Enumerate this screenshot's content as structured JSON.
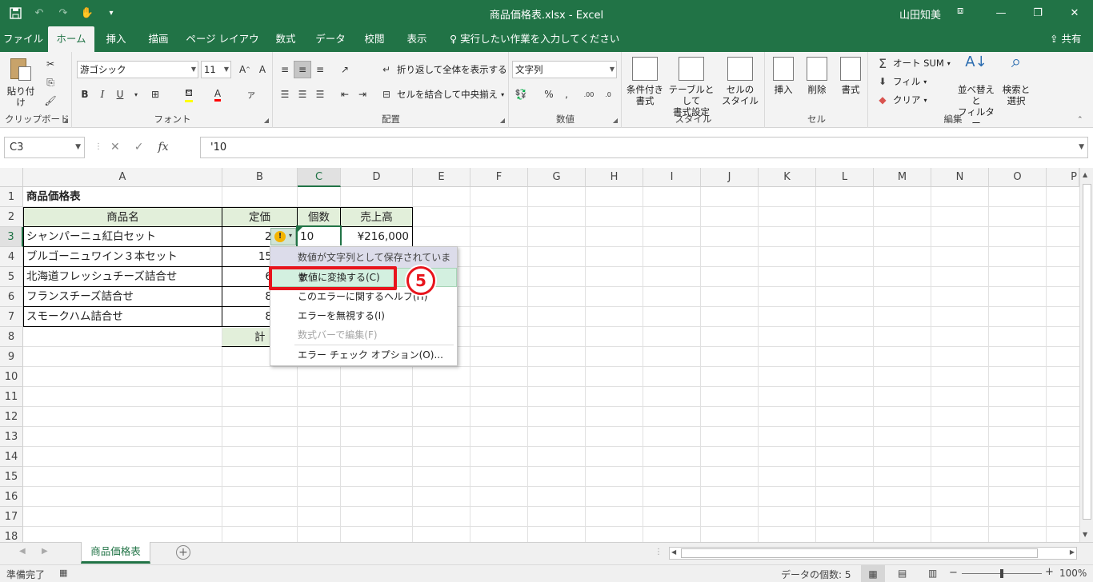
{
  "window": {
    "title": "商品価格表.xlsx  -  Excel",
    "user": "山田知美"
  },
  "tabs": [
    "ファイル",
    "ホーム",
    "挿入",
    "描画",
    "ページ レイアウト",
    "数式",
    "データ",
    "校閲",
    "表示"
  ],
  "tell_me": "実行したい作業を入力してください",
  "share": "共有",
  "ribbon": {
    "clipboard": {
      "label": "クリップボード",
      "paste": "貼り付け"
    },
    "font": {
      "label": "フォント",
      "name": "游ゴシック",
      "size": "11",
      "bold": "B",
      "italic": "I",
      "underline": "U"
    },
    "alignment": {
      "label": "配置",
      "wrap": "折り返して全体を表示する",
      "merge": "セルを結合して中央揃え"
    },
    "number": {
      "label": "数値",
      "format": "文字列"
    },
    "styles": {
      "label": "スタイル",
      "conditional": [
        "条件付き",
        "書式"
      ],
      "table": [
        "テーブルとして",
        "書式設定"
      ],
      "cell": [
        "セルの",
        "スタイル"
      ]
    },
    "cells": {
      "label": "セル",
      "insert": "挿入",
      "delete": "削除",
      "format": "書式"
    },
    "editing": {
      "label": "編集",
      "autosum": "オート SUM",
      "fill": "フィル",
      "clear": "クリア",
      "sort": [
        "並べ替えと",
        "フィルター"
      ],
      "find": [
        "検索と",
        "選択"
      ]
    }
  },
  "formula_bar": {
    "name_box": "C3",
    "formula": "'10"
  },
  "columns": [
    "A",
    "B",
    "C",
    "D",
    "E",
    "F",
    "G",
    "H",
    "I",
    "J",
    "K",
    "L",
    "M",
    "N",
    "O",
    "P"
  ],
  "rows": [
    "1",
    "2",
    "3",
    "4",
    "5",
    "6",
    "7",
    "8",
    "9",
    "10",
    "11",
    "12",
    "13",
    "14",
    "15",
    "16",
    "17",
    "18"
  ],
  "sheet": {
    "title": "商品価格表",
    "headers": [
      "商品名",
      "定価",
      "個数",
      "売上高"
    ],
    "items": [
      {
        "name": "シャンパーニュ紅白セット",
        "price": "21",
        "qty": "10",
        "sales": "¥216,000"
      },
      {
        "name": "ブルゴーニュワイン３本セット",
        "price": "15",
        "qty": "",
        "sales": ""
      },
      {
        "name": "北海道フレッシュチーズ詰合せ",
        "price": "6",
        "qty": "",
        "sales": ""
      },
      {
        "name": "フランスチーズ詰合せ",
        "price": "8",
        "qty": "",
        "sales": ""
      },
      {
        "name": "スモークハム詰合せ",
        "price": "8",
        "qty": "",
        "sales": ""
      }
    ],
    "total_label": "計"
  },
  "context_menu": {
    "header": "数値が文字列として保存されています",
    "items": [
      "数値に変換する(C)",
      "このエラーに関するヘルプ(H)",
      "エラーを無視する(I)",
      "数式バーで編集(F)",
      "エラー チェック オプション(O)..."
    ]
  },
  "step_badge": "5",
  "sheet_tab": "商品価格表",
  "status": {
    "ready": "準備完了",
    "count": "データの個数: 5",
    "zoom": "100%"
  },
  "colors": {
    "excel_green": "#217346",
    "highlight_red": "#e8141c",
    "menu_hover": "#d3f0e0"
  }
}
